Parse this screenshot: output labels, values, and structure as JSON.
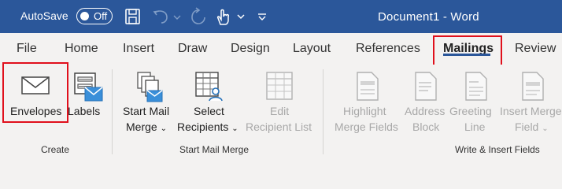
{
  "titlebar": {
    "autosave_label": "AutoSave",
    "autosave_state": "Off",
    "document_title": "Document1  -  Word"
  },
  "tabs": [
    {
      "label": "File"
    },
    {
      "label": "Home"
    },
    {
      "label": "Insert"
    },
    {
      "label": "Draw"
    },
    {
      "label": "Design"
    },
    {
      "label": "Layout"
    },
    {
      "label": "References"
    },
    {
      "label": "Mailings",
      "active": true
    },
    {
      "label": "Review"
    }
  ],
  "ribbon": {
    "create": {
      "group_label": "Create",
      "envelopes": "Envelopes",
      "labels": "Labels"
    },
    "start_mail_merge": {
      "group_label": "Start Mail Merge",
      "start_line1": "Start Mail",
      "start_line2": "Merge",
      "select_line1": "Select",
      "select_line2": "Recipients",
      "edit_line1": "Edit",
      "edit_line2": "Recipient List"
    },
    "write_insert": {
      "group_label": "Write & Insert Fields",
      "highlight_line1": "Highlight",
      "highlight_line2": "Merge Fields",
      "address_line1": "Address",
      "address_line2": "Block",
      "greeting_line1": "Greeting",
      "greeting_line2": "Line",
      "insert_line1": "Insert Merge",
      "insert_line2": "Field"
    }
  },
  "colors": {
    "titlebar": "#2b579a",
    "highlight_box": "#e0101c",
    "disabled_text": "#a8a8a8"
  }
}
